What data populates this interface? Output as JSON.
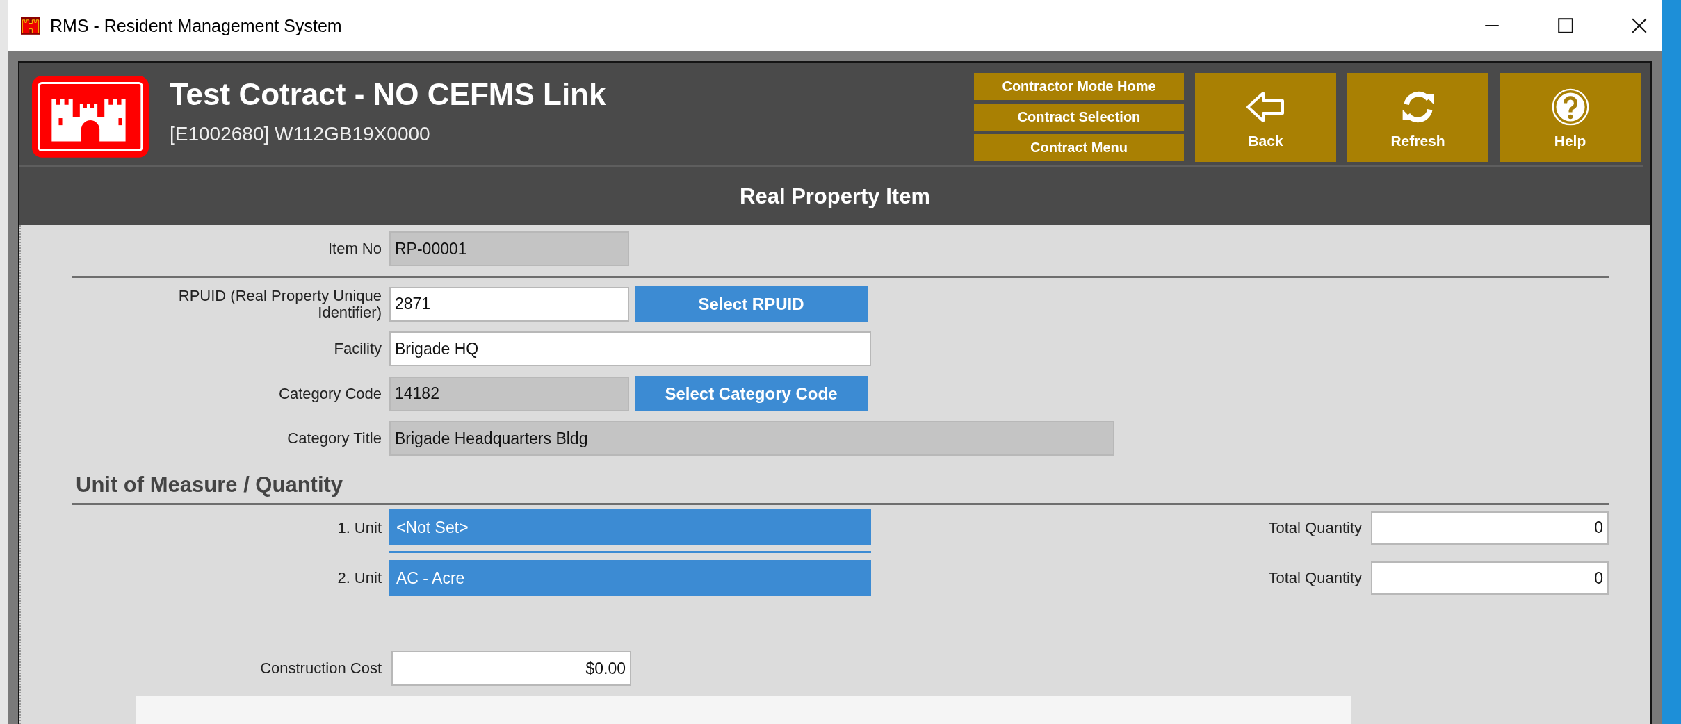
{
  "window": {
    "title": "RMS - Resident Management System"
  },
  "header": {
    "title": "Test Cotract - NO CEFMS Link",
    "subtitle": "[E1002680] W112GB19X0000",
    "nav_links": [
      "Contractor Mode Home",
      "Contract Selection",
      "Contract Menu"
    ],
    "buttons": [
      {
        "label": "Back",
        "kind": "back"
      },
      {
        "label": "Refresh",
        "kind": "refresh"
      },
      {
        "label": "Help",
        "kind": "help"
      }
    ]
  },
  "page_title": "Real Property Item",
  "item_no": {
    "label": "Item No",
    "value": "RP-00001",
    "readonly": true
  },
  "property_fields": [
    {
      "label": "RPUID (Real Property Unique Identifier)",
      "value": "2871",
      "readonly": false,
      "button": "Select RPUID"
    },
    {
      "label": "Facility",
      "value": "Brigade HQ",
      "readonly": false
    },
    {
      "label": "Category Code",
      "value": "14182",
      "readonly": true,
      "button": "Select Category Code"
    },
    {
      "label": "Category Title",
      "value": "Brigade Headquarters Bldg",
      "readonly": true
    }
  ],
  "unit_section": {
    "heading": "Unit of Measure / Quantity",
    "rows": [
      {
        "unit_label": "1. Unit",
        "unit": "<Not Set>",
        "quantity_label": "Total Quantity",
        "quantity": "0"
      },
      {
        "unit_label": "2. Unit",
        "unit": "AC - Acre",
        "quantity_label": "Total Quantity",
        "quantity": "0"
      }
    ]
  },
  "construction_cost": {
    "label": "Construction Cost",
    "value": "$0.00"
  }
}
